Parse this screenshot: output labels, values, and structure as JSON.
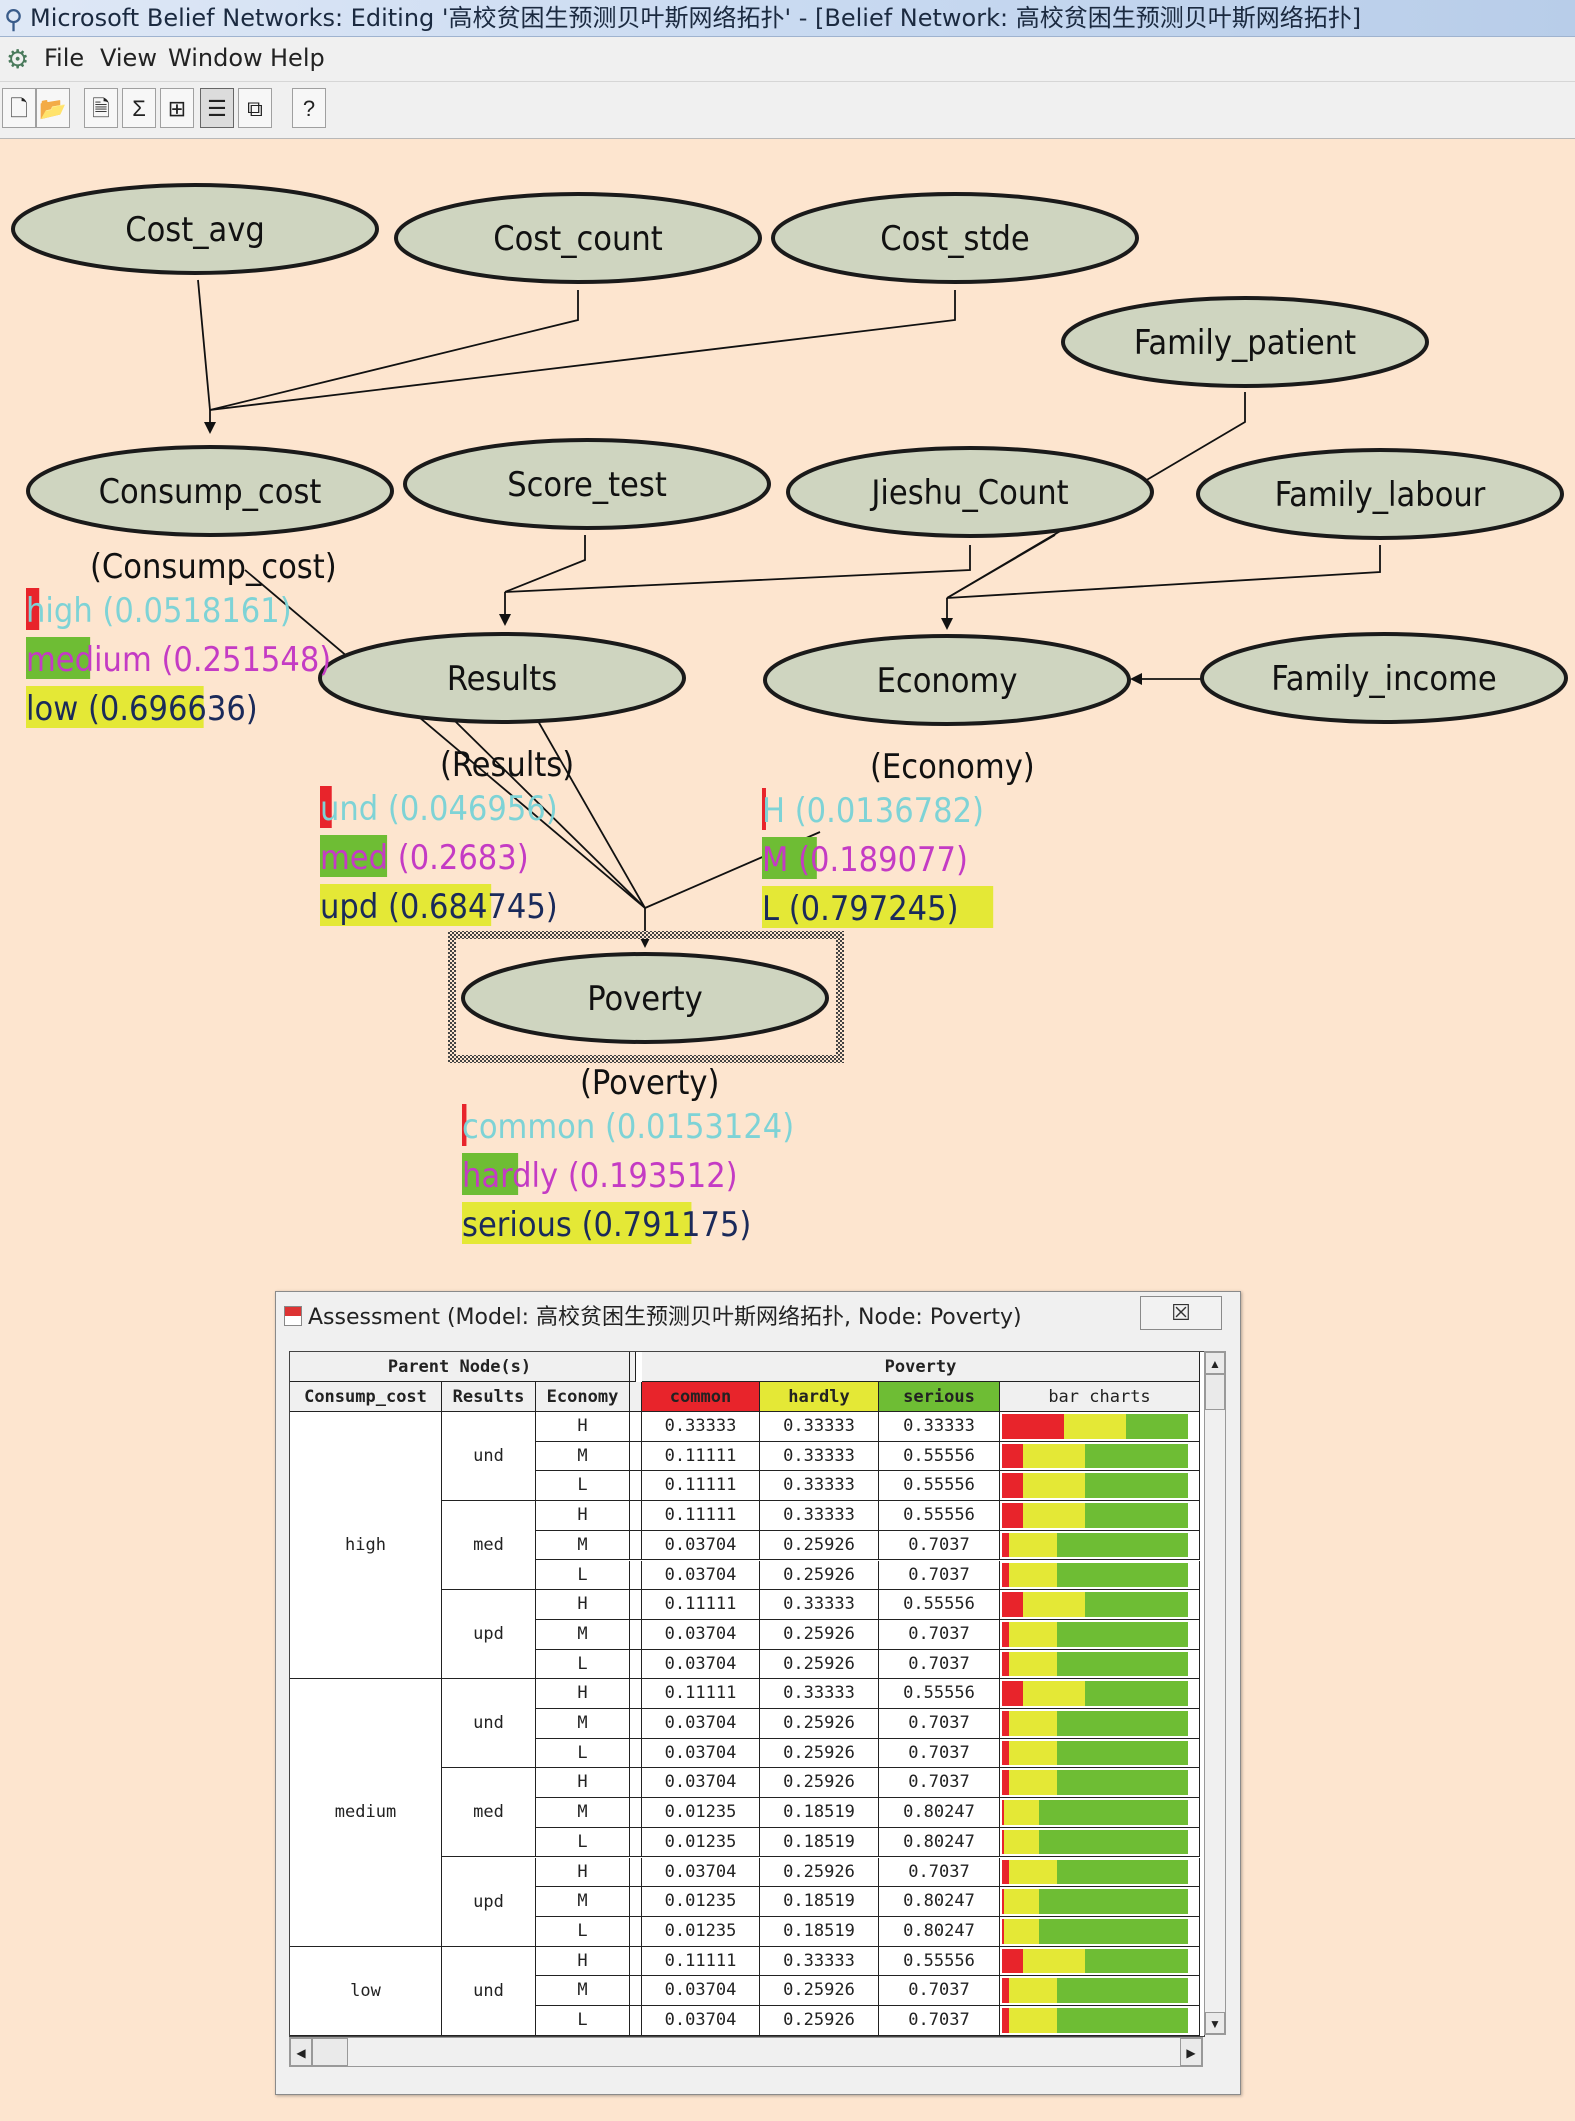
{
  "window": {
    "title": "Microsoft Belief Networks: Editing '高校贫困生预测贝叶斯网络拓扑' - [Belief Network: 高校贫困生预测贝叶斯网络拓扑]"
  },
  "menu": [
    "File",
    "View",
    "Window",
    "Help"
  ],
  "toolbar": [
    {
      "icon": "new-file-icon",
      "glyph": "🗋"
    },
    {
      "icon": "open-folder-icon",
      "glyph": "📂"
    },
    {
      "icon": "properties-icon",
      "glyph": "🗎"
    },
    {
      "icon": "sigma-icon",
      "glyph": "Σ"
    },
    {
      "icon": "node-tree-icon",
      "glyph": "⊞"
    },
    {
      "icon": "bar-display-icon",
      "glyph": "☰"
    },
    {
      "icon": "network-icon",
      "glyph": "⧉"
    },
    {
      "icon": "help-icon",
      "glyph": "?"
    }
  ],
  "network": {
    "nodes": [
      "Cost_avg",
      "Cost_count",
      "Cost_stde",
      "Family_patient",
      "Consump_cost",
      "Score_test",
      "Jieshu_Count",
      "Family_labour",
      "Results",
      "Economy",
      "Family_income",
      "Poverty"
    ],
    "state_colors": {
      "first": "#e8242b",
      "second": "#6ebd34",
      "third": "#e4e836"
    },
    "text_colors": {
      "first": "#7ed3d6",
      "second": "#c43bc4",
      "third": "#1a2a5a"
    },
    "panels": [
      {
        "title": "(Consump_cost)",
        "states": [
          {
            "label": "high (0.0518161)",
            "p": 0.0518161
          },
          {
            "label": "medium (0.251548)",
            "p": 0.251548
          },
          {
            "label": "low (0.696636)",
            "p": 0.696636
          }
        ]
      },
      {
        "title": "(Results)",
        "states": [
          {
            "label": "und (0.046956)",
            "p": 0.046956
          },
          {
            "label": "med (0.2683)",
            "p": 0.2683
          },
          {
            "label": "upd (0.684745)",
            "p": 0.684745
          }
        ]
      },
      {
        "title": "(Economy)",
        "states": [
          {
            "label": "H (0.0136782)",
            "p": 0.0136782
          },
          {
            "label": "M (0.189077)",
            "p": 0.189077
          },
          {
            "label": "L (0.797245)",
            "p": 0.797245
          }
        ]
      },
      {
        "title": "(Poverty)",
        "states": [
          {
            "label": "common (0.0153124)",
            "p": 0.0153124
          },
          {
            "label": "hardly (0.193512)",
            "p": 0.193512
          },
          {
            "label": "serious (0.791175)",
            "p": 0.791175
          }
        ]
      }
    ]
  },
  "assessment": {
    "title": "Assessment (Model: 高校贫困生预测贝叶斯网络拓扑, Node: Poverty)",
    "close_glyph": "☒",
    "header_parent": "Parent Node(s)",
    "header_node": "Poverty",
    "col_consump": "Consump_cost",
    "col_results": "Results",
    "col_economy": "Economy",
    "col_common": "common",
    "col_hardly": "hardly",
    "col_serious": "serious",
    "col_bars": "bar charts",
    "col_colors": {
      "common": "#e8242b",
      "hardly": "#e4e836",
      "serious": "#6ebd34"
    },
    "consump_groups": [
      {
        "label": "high",
        "rows": 9
      },
      {
        "label": "medium",
        "rows": 9
      },
      {
        "label": "low",
        "rows": 3
      }
    ],
    "results_groups": [
      {
        "label": "und",
        "rows": 3
      },
      {
        "label": "med",
        "rows": 3
      },
      {
        "label": "upd",
        "rows": 3
      },
      {
        "label": "und",
        "rows": 3
      },
      {
        "label": "med",
        "rows": 3
      },
      {
        "label": "upd",
        "rows": 3
      },
      {
        "label": "und",
        "rows": 3
      }
    ],
    "rows": [
      {
        "econ": "H",
        "common": "0.33333",
        "hardly": "0.33333",
        "serious": "0.33333"
      },
      {
        "econ": "M",
        "common": "0.11111",
        "hardly": "0.33333",
        "serious": "0.55556"
      },
      {
        "econ": "L",
        "common": "0.11111",
        "hardly": "0.33333",
        "serious": "0.55556"
      },
      {
        "econ": "H",
        "common": "0.11111",
        "hardly": "0.33333",
        "serious": "0.55556"
      },
      {
        "econ": "M",
        "common": "0.03704",
        "hardly": "0.25926",
        "serious": "0.7037"
      },
      {
        "econ": "L",
        "common": "0.03704",
        "hardly": "0.25926",
        "serious": "0.7037"
      },
      {
        "econ": "H",
        "common": "0.11111",
        "hardly": "0.33333",
        "serious": "0.55556"
      },
      {
        "econ": "M",
        "common": "0.03704",
        "hardly": "0.25926",
        "serious": "0.7037"
      },
      {
        "econ": "L",
        "common": "0.03704",
        "hardly": "0.25926",
        "serious": "0.7037"
      },
      {
        "econ": "H",
        "common": "0.11111",
        "hardly": "0.33333",
        "serious": "0.55556"
      },
      {
        "econ": "M",
        "common": "0.03704",
        "hardly": "0.25926",
        "serious": "0.7037"
      },
      {
        "econ": "L",
        "common": "0.03704",
        "hardly": "0.25926",
        "serious": "0.7037"
      },
      {
        "econ": "H",
        "common": "0.03704",
        "hardly": "0.25926",
        "serious": "0.7037"
      },
      {
        "econ": "M",
        "common": "0.01235",
        "hardly": "0.18519",
        "serious": "0.80247"
      },
      {
        "econ": "L",
        "common": "0.01235",
        "hardly": "0.18519",
        "serious": "0.80247"
      },
      {
        "econ": "H",
        "common": "0.03704",
        "hardly": "0.25926",
        "serious": "0.7037"
      },
      {
        "econ": "M",
        "common": "0.01235",
        "hardly": "0.18519",
        "serious": "0.80247"
      },
      {
        "econ": "L",
        "common": "0.01235",
        "hardly": "0.18519",
        "serious": "0.80247"
      },
      {
        "econ": "H",
        "common": "0.11111",
        "hardly": "0.33333",
        "serious": "0.55556"
      },
      {
        "econ": "M",
        "common": "0.03704",
        "hardly": "0.25926",
        "serious": "0.7037"
      },
      {
        "econ": "L",
        "common": "0.03704",
        "hardly": "0.25926",
        "serious": "0.7037"
      }
    ]
  }
}
